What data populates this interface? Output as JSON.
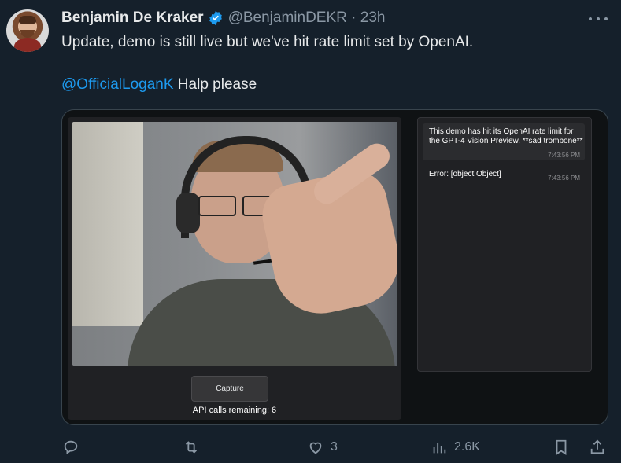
{
  "tweet": {
    "author_name": "Benjamin De Kraker",
    "handle_time": "@BenjaminDEKR · 23h",
    "text_line1": "Update, demo is still live but we've hit rate limit set by OpenAI.",
    "mention": "@OfficialLoganK",
    "text_line2_rest": " Halp please"
  },
  "app": {
    "capture_label": "Capture",
    "api_calls": "API calls remaining: 6",
    "messages": [
      {
        "text": "This demo has hit its OpenAI rate limit for the GPT-4 Vision Preview. **sad trombone**",
        "time": "7:43:56 PM"
      },
      {
        "text": "Error: [object Object]",
        "time": "7:43:56 PM"
      }
    ]
  },
  "actions": {
    "reply_count": "",
    "retweet_count": "",
    "like_count": "3",
    "views_count": "2.6K"
  },
  "colors": {
    "background": "#15202b",
    "accent": "#1d9bf0",
    "muted": "#8b98a5"
  }
}
